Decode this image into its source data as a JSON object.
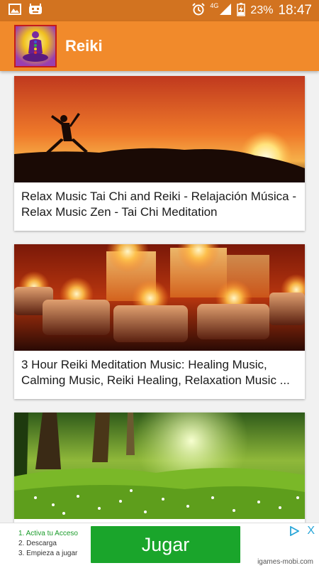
{
  "status_bar": {
    "network": "4G",
    "battery": "23%",
    "time": "18:47"
  },
  "app_bar": {
    "title": "Reiki"
  },
  "videos": [
    {
      "title": "Relax Music Tai Chi and Reiki - Relajación Música - Relax Music Zen - Tai Chi Meditation"
    },
    {
      "title": "3 Hour Reiki Meditation Music: Healing Music, Calming Music, Reiki Healing, Relaxation Music ..."
    },
    {
      "title": ""
    }
  ],
  "ad": {
    "steps": [
      "1. Activa tu Acceso",
      "2. Descarga",
      "3. Empieza a jugar"
    ],
    "button_label": "Jugar",
    "domain": "igames-mobi.com",
    "close_label": "X"
  }
}
